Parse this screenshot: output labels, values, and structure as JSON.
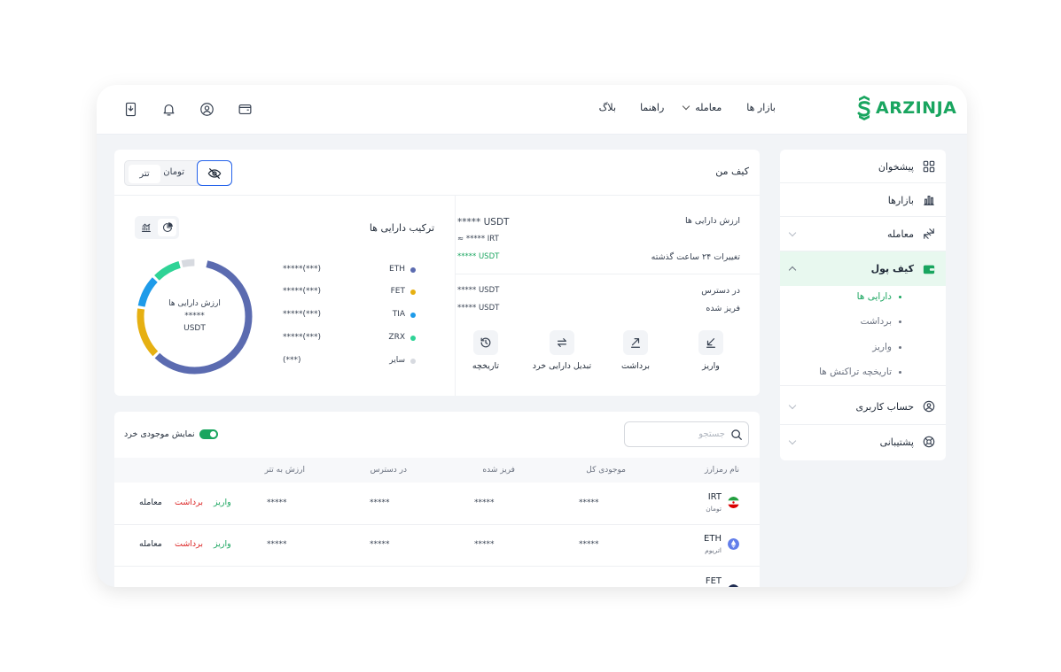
{
  "logo": {
    "text": "ARZINJA",
    "color": "#19a55f"
  },
  "nav": {
    "markets": "بازار ها",
    "trade": "معامله",
    "guide": "راهنما",
    "blog": "بلاگ"
  },
  "sidebar": {
    "items": [
      {
        "label": "پیشخوان",
        "icon": "dashboard-grid-icon"
      },
      {
        "label": "بازارها",
        "icon": "bar-chart-icon"
      },
      {
        "label": "معامله",
        "icon": "exchange-arrows-icon"
      },
      {
        "label": "کیف پول",
        "icon": "wallet-icon"
      },
      {
        "label": "حساب کاربری",
        "icon": "user-circle-icon"
      },
      {
        "label": "پشتیبانی",
        "icon": "support-lifebuoy-icon"
      }
    ],
    "wallet_sub": [
      "دارایی ها",
      "برداشت",
      "واریز",
      "تاریخچه تراکنش ها"
    ]
  },
  "wallet": {
    "title": "کیف من",
    "currency_toman": "تومان",
    "currency_tether": "تتر",
    "asset_value_label": "ارزش دارایی ها",
    "asset_value_usdt": "***** USDT",
    "asset_value_irt": "≈ ***** IRT",
    "change_24h_label": "تغییرات ۲۴ ساعت گذشته",
    "change_24h_value": "***** USDT",
    "available_label": "در دسترس",
    "available_value": "***** USDT",
    "frozen_label": "فریز شده",
    "frozen_value": "***** USDT",
    "actions": {
      "deposit": "واریز",
      "withdraw": "برداشت",
      "convert": "تبدیل دارایی خرد",
      "history": "تاریخچه"
    }
  },
  "composition": {
    "title": "ترکیب دارایی ها",
    "donut_label": "ارزش دارایی ها",
    "donut_value": "*****",
    "donut_unit": "USDT",
    "legend": [
      {
        "name": "ETH",
        "value": "*****(***)",
        "color": "#5b6bb0"
      },
      {
        "name": "FET",
        "value": "*****(***)",
        "color": "#e6b012"
      },
      {
        "name": "TIA",
        "value": "*****(***)",
        "color": "#1e9be9"
      },
      {
        "name": "ZRX",
        "value": "*****(***)",
        "color": "#2fd396"
      },
      {
        "name": "سایر",
        "value": "(***)",
        "color": "#d7dae0"
      }
    ]
  },
  "table": {
    "search_placeholder": "جستجو",
    "show_dust_label": "نمایش موجودی خرد",
    "headers": {
      "coin": "نام رمزارز",
      "total": "موجودی کل",
      "frozen": "فریز شده",
      "available": "در دسترس",
      "usdt_value": "ارزش به تتر"
    },
    "rows": [
      {
        "symbol": "IRT",
        "name": "تومان",
        "total": "*****",
        "frozen": "*****",
        "available": "*****",
        "usdt_value": "*****",
        "deposit": "واریز",
        "withdraw": "برداشت",
        "trade": "معامله"
      },
      {
        "symbol": "ETH",
        "name": "اتریوم",
        "total": "*****",
        "frozen": "*****",
        "available": "*****",
        "usdt_value": "*****",
        "deposit": "واریز",
        "withdraw": "برداشت",
        "trade": "معامله"
      },
      {
        "symbol": "FET",
        "name": "",
        "total": "",
        "frozen": "",
        "available": "",
        "usdt_value": "",
        "deposit": "",
        "withdraw": "",
        "trade": ""
      }
    ]
  }
}
